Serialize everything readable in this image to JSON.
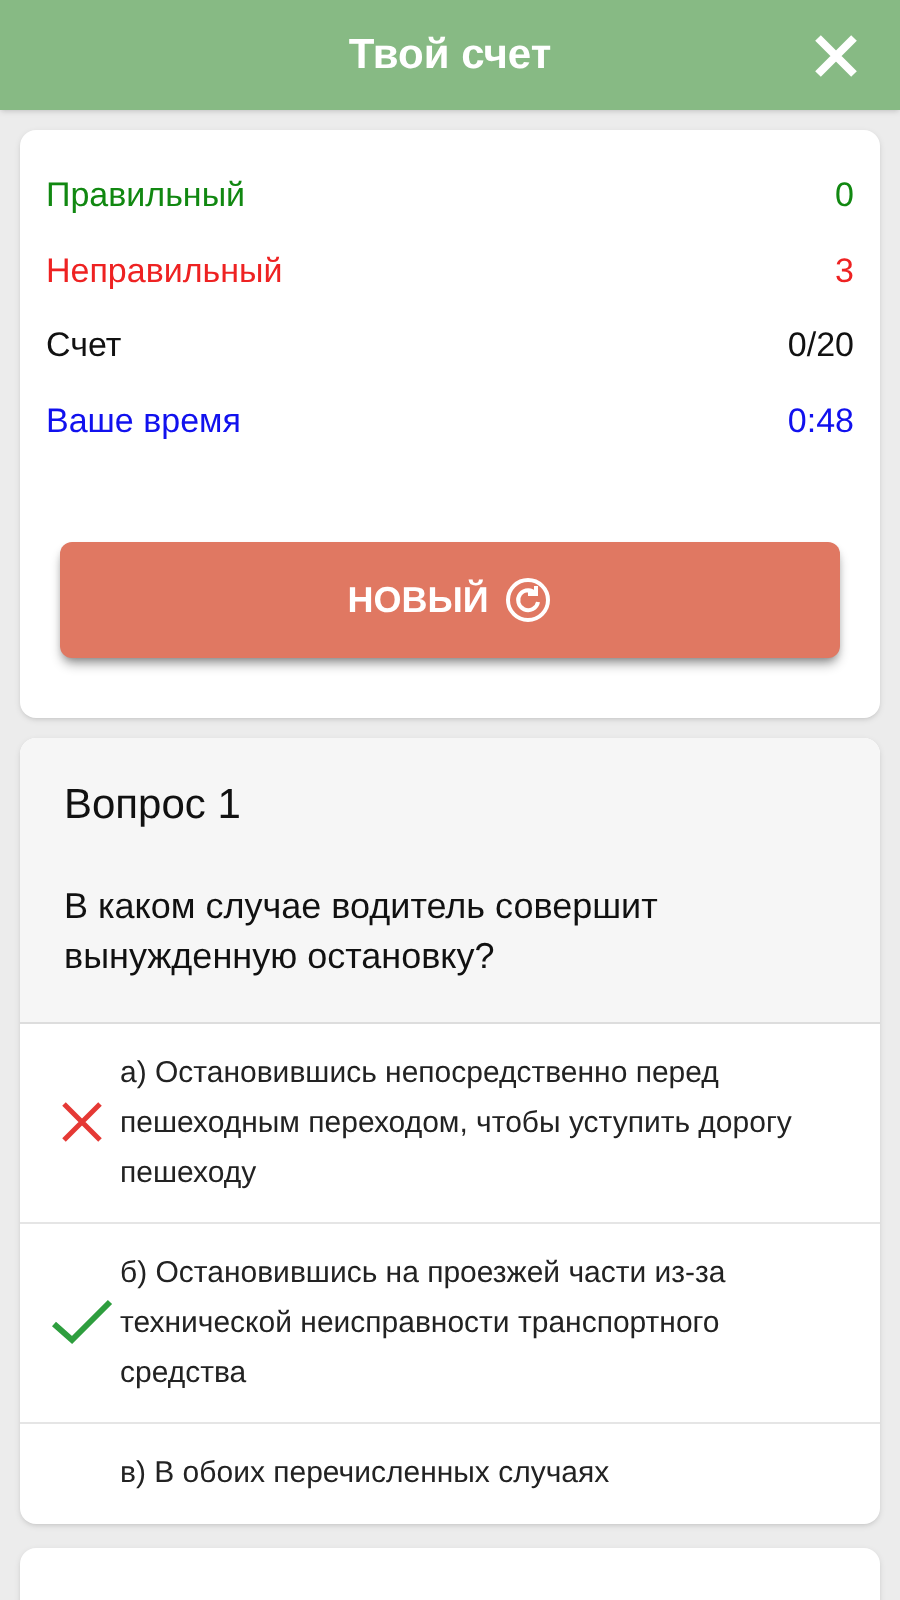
{
  "header": {
    "title": "Твой счет"
  },
  "stats": [
    {
      "label": "Правильный",
      "value": "0",
      "color": "#118811"
    },
    {
      "label": "Неправильный",
      "value": "3",
      "color": "#ee2222"
    },
    {
      "label": "Счет",
      "value": "0/20",
      "color": "#111111"
    },
    {
      "label": "Ваше время",
      "value": "0:48",
      "color": "#1111ee"
    }
  ],
  "new_button": {
    "label": "НОВЫЙ"
  },
  "question": {
    "title": "Вопрос 1",
    "text": "В каком случае водитель совершит вынужденную остановку?",
    "answers": [
      {
        "text": "а) Остановившись непосредственно перед пешеходным переходом, чтобы уступить дорогу пешеходу",
        "kind": "wrong"
      },
      {
        "text": "б) Остановившись на проезжей части из-за технической неисправности транспортного средства",
        "kind": "correct"
      },
      {
        "text": "в) В обоих перечисленных случаях",
        "kind": "plain"
      }
    ]
  }
}
